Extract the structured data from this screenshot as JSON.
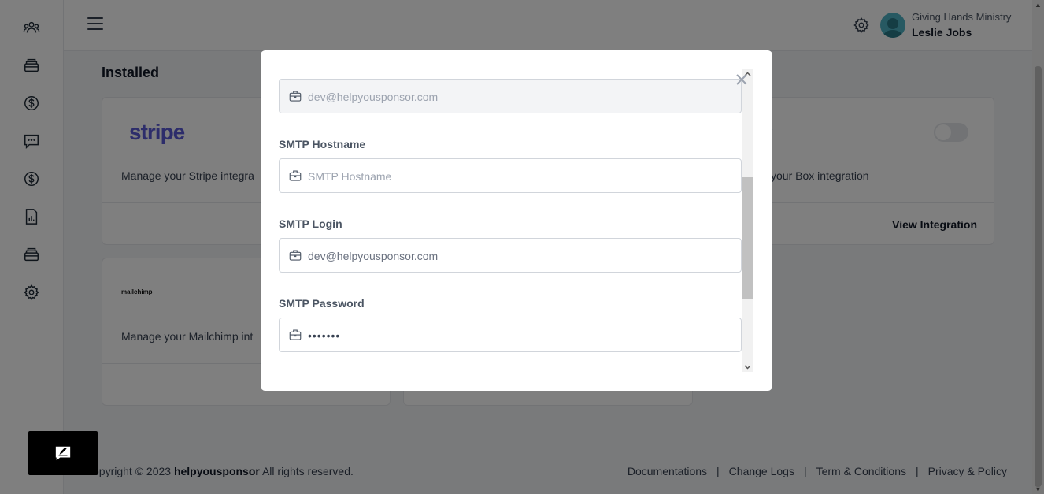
{
  "header": {
    "org_name": "Giving Hands Ministry",
    "user_name": "Leslie Jobs"
  },
  "sidebar": {
    "icons": [
      "users-icon",
      "archive-icon",
      "dollar-circle-icon",
      "chat-icon",
      "dollar-circle-icon",
      "report-icon",
      "archive-icon",
      "gear-icon"
    ]
  },
  "main": {
    "section_title": "Installed",
    "cards": [
      {
        "logo": "stripe",
        "description": "Manage your Stripe integra"
      },
      {
        "logo": "x",
        "description": "your Box integration",
        "link": "View Integration"
      },
      {
        "logo": "mailchimp",
        "description": "Manage your Mailchimp int"
      }
    ]
  },
  "modal": {
    "fields": [
      {
        "label": "",
        "value": "dev@helpyousponsor.com",
        "placeholder": "",
        "disabled": true
      },
      {
        "label": "SMTP Hostname",
        "value": "",
        "placeholder": "SMTP Hostname"
      },
      {
        "label": "SMTP Login",
        "value": "dev@helpyousponsor.com",
        "placeholder": ""
      },
      {
        "label": "SMTP Password",
        "value": "•••••••",
        "placeholder": ""
      }
    ]
  },
  "footer": {
    "copyright_prefix": "opyright © 2023 ",
    "brand": "helpyousponsor",
    "copyright_suffix": " All rights reserved.",
    "links": [
      "Documentations",
      "Change Logs",
      "Term & Conditions",
      "Privacy & Policy"
    ]
  }
}
